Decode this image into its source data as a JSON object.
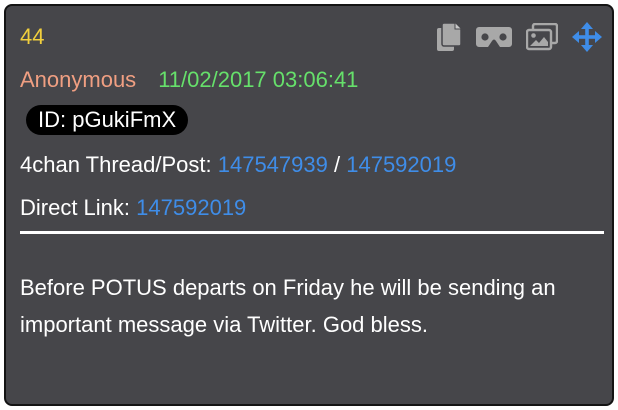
{
  "post": {
    "number": "44",
    "author": "Anonymous",
    "timestamp": "11/02/2017 03:06:41",
    "id_label": "ID: pGukiFmX",
    "thread_label": "4chan Thread/Post:",
    "thread_link": "147547939",
    "separator": "/",
    "post_link": "147592019",
    "direct_label": "Direct Link:",
    "direct_link": "147592019",
    "text": "Before POTUS departs on Friday he will be sending an important message via Twitter. God bless."
  },
  "toolbar": {
    "icons": [
      "copy-icon",
      "vr-viewer-icon",
      "images-icon",
      "move-icon"
    ]
  },
  "colors": {
    "background": "#46464a",
    "number": "#f1cf3d",
    "author": "#f09f82",
    "timestamp": "#66e06b",
    "link": "#3f8de8",
    "icon": "#a8a8a8",
    "move_icon": "#3f8de8"
  }
}
